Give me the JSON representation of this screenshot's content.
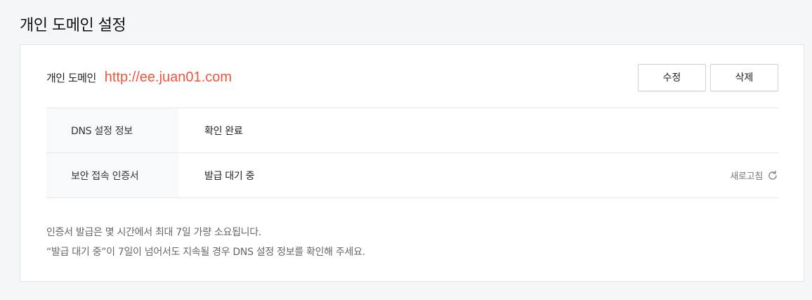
{
  "page": {
    "title": "개인 도메인 설정"
  },
  "domain": {
    "label": "개인 도메인",
    "url": "http://ee.juan01.com",
    "edit_label": "수정",
    "delete_label": "삭제"
  },
  "info": {
    "rows": [
      {
        "key": "DNS 설정 정보",
        "value": "확인 완료"
      },
      {
        "key": "보안 접속 인증서",
        "value": "발급 대기 중"
      }
    ],
    "refresh_label": "새로고침",
    "refresh_icon": "refresh-icon"
  },
  "notes": [
    "인증서 발급은 몇 시간에서 최대 7일 가량 소요됩니다.",
    "“발급 대기 중”이 7일이 넘어서도 지속될 경우 DNS 설정 정보를 확인해 주세요."
  ],
  "colors": {
    "accent": "#f0563c",
    "background": "#f5f6f8",
    "key_cell": "#f8f9fa"
  }
}
